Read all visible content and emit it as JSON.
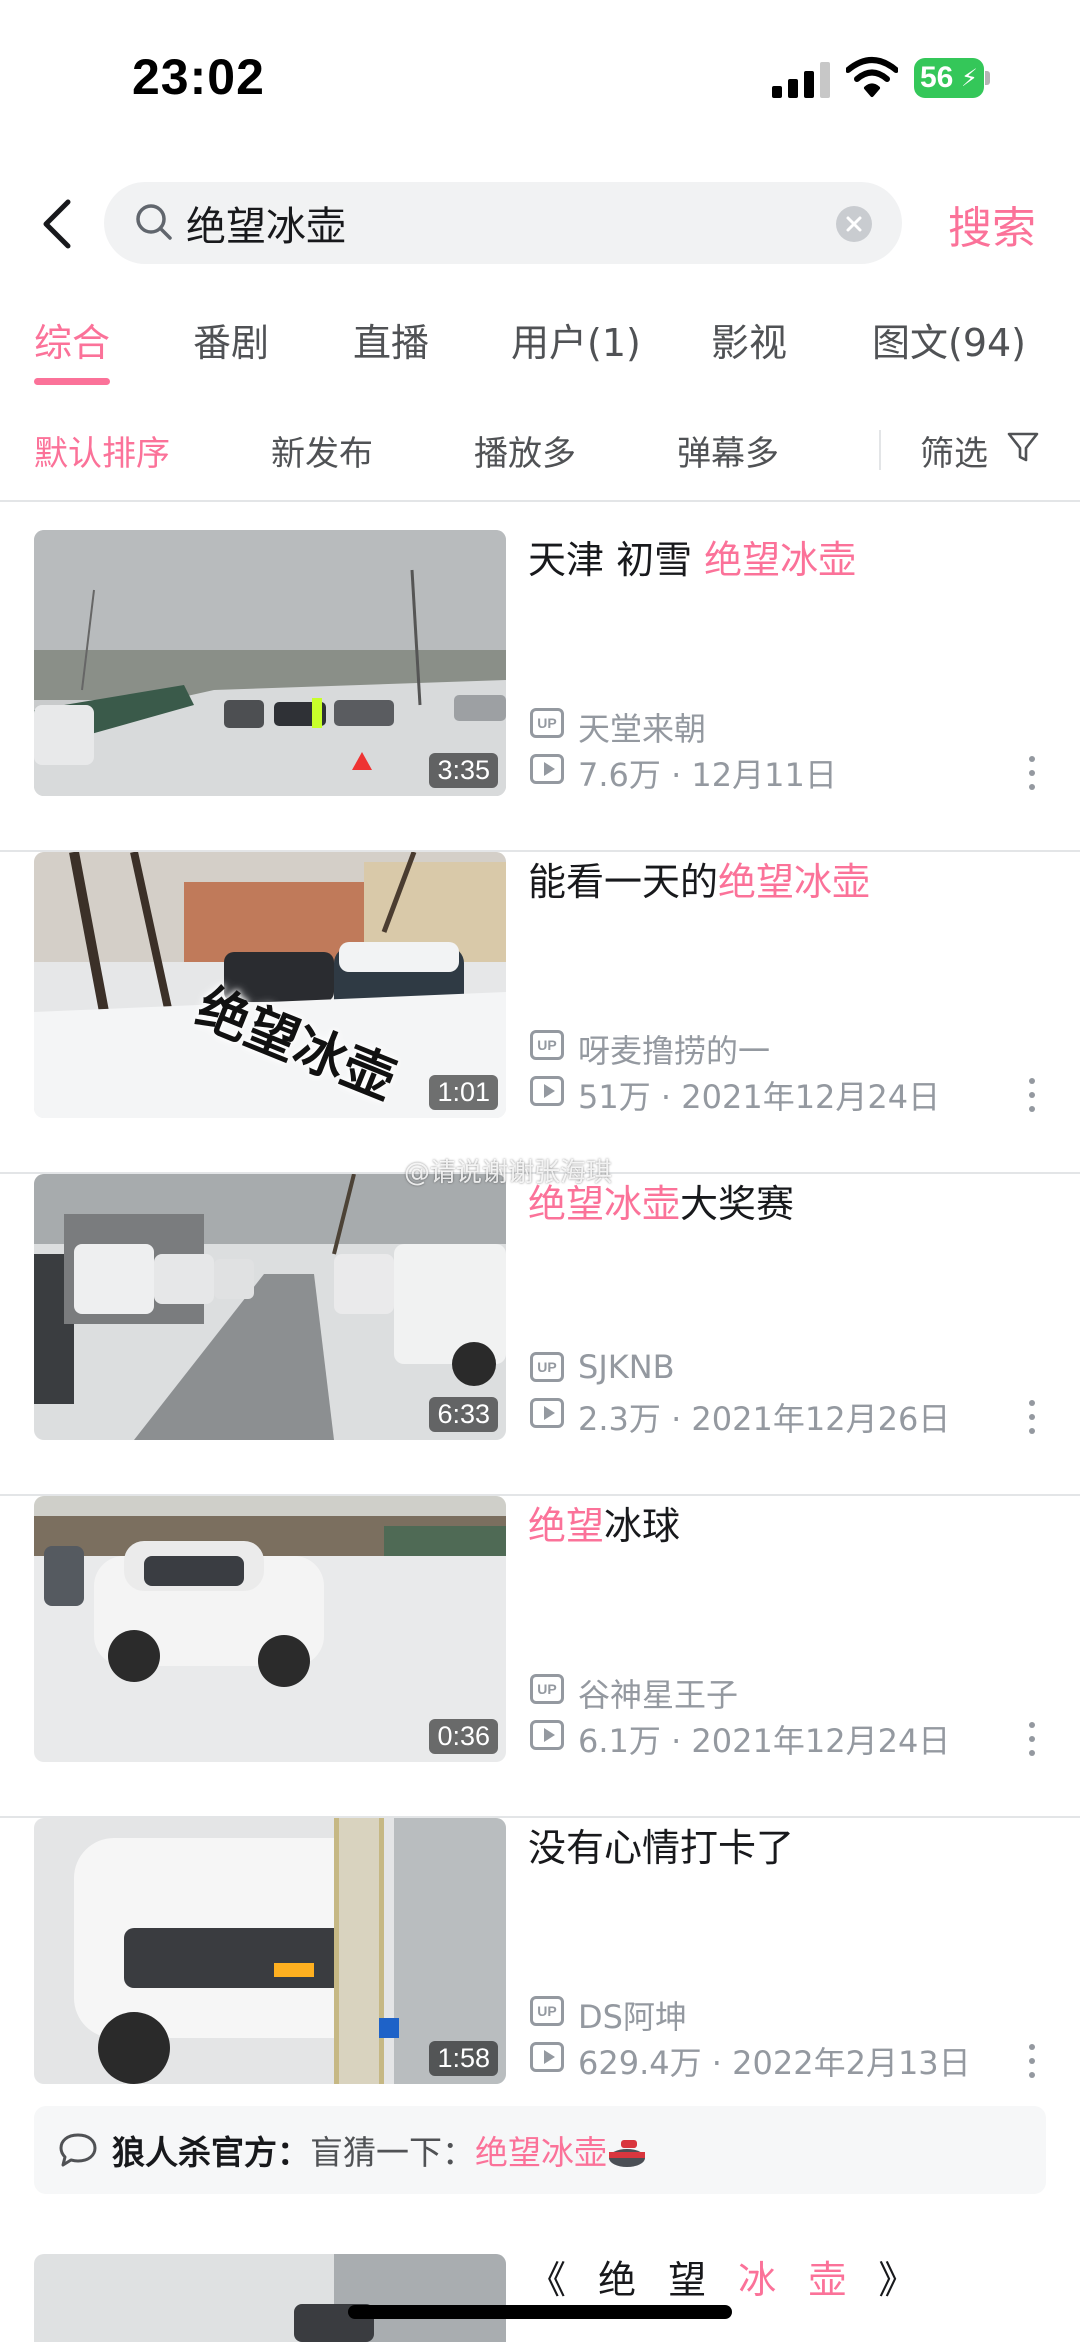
{
  "status_bar": {
    "time": "23:02",
    "battery": "56"
  },
  "search": {
    "query": "绝望冰壶",
    "submit_label": "搜索"
  },
  "tabs": [
    {
      "label": "综合",
      "active": true
    },
    {
      "label": "番剧"
    },
    {
      "label": "直播"
    },
    {
      "label": "用户(1)"
    },
    {
      "label": "影视"
    },
    {
      "label": "图文(94)"
    }
  ],
  "sort": {
    "items": [
      {
        "label": "默认排序",
        "active": true
      },
      {
        "label": "新发布"
      },
      {
        "label": "播放多"
      },
      {
        "label": "弹幕多"
      }
    ],
    "filter_label": "筛选"
  },
  "videos": [
    {
      "title_pre": "天津 初雪  ",
      "title_hl": "绝望冰壶",
      "title_post": "",
      "uploader": "天堂来朝",
      "views": "7.6万",
      "date": "12月11日",
      "duration": "3:35"
    },
    {
      "title_pre": "能看一天的",
      "title_hl": "绝望冰壶",
      "title_post": "",
      "uploader": "呀麦撸捞的一",
      "views": "51万",
      "date": "2021年12月24日",
      "duration": "1:01",
      "thumb_text": "绝望冰壶"
    },
    {
      "title_pre": "",
      "title_hl": "绝望冰壶",
      "title_post": "大奖赛",
      "uploader": "SJKNB",
      "views": "2.3万",
      "date": "2021年12月26日",
      "duration": "6:33"
    },
    {
      "title_pre": "",
      "title_hl": "绝望",
      "title_post": "冰球",
      "uploader": "谷神星王子",
      "views": "6.1万",
      "date": "2021年12月24日",
      "duration": "0:36"
    },
    {
      "title_pre": "没有心情打卡了",
      "title_hl": "",
      "title_post": "",
      "uploader": "DS阿坤",
      "views": "629.4万",
      "date": "2022年2月13日",
      "duration": "1:58"
    }
  ],
  "comment": {
    "author": "狼人杀官方：",
    "text": "盲猜一下：",
    "highlight": "绝望冰壶"
  },
  "partial_video": {
    "title_pre": "《 绝 望 ",
    "title_hl": "冰 壶",
    "title_post": " 》"
  },
  "watermark": "@请说谢谢张海琪",
  "separator": " · ",
  "up_badge": "UP",
  "icons": {
    "back": "chevron-left-icon",
    "search": "search-icon",
    "clear": "clear-icon",
    "filter": "funnel-icon",
    "play": "play-count-icon",
    "up": "up-badge-icon",
    "more": "more-vertical-icon",
    "comment": "comment-bubble-icon",
    "curling": "curling-stone-icon"
  },
  "colors": {
    "accent": "#fb7299",
    "secondary_text": "#9499a0",
    "primary_text": "#18191c"
  }
}
